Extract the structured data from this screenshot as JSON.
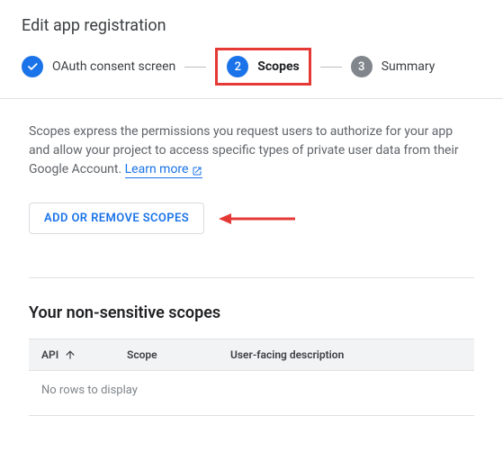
{
  "header": {
    "title": "Edit app registration"
  },
  "stepper": {
    "step1": {
      "label": "OAuth consent screen"
    },
    "step2": {
      "num": "2",
      "label": "Scopes"
    },
    "step3": {
      "num": "3",
      "label": "Summary"
    }
  },
  "content": {
    "description": "Scopes express the permissions you request users to authorize for your app and allow your project to access specific types of private user data from their Google Account. ",
    "learn_more": "Learn more",
    "button": "ADD OR REMOVE SCOPES"
  },
  "section": {
    "title": "Your non-sensitive scopes",
    "columns": {
      "api": "API",
      "scope": "Scope",
      "desc": "User-facing description"
    },
    "empty": "No rows to display"
  }
}
